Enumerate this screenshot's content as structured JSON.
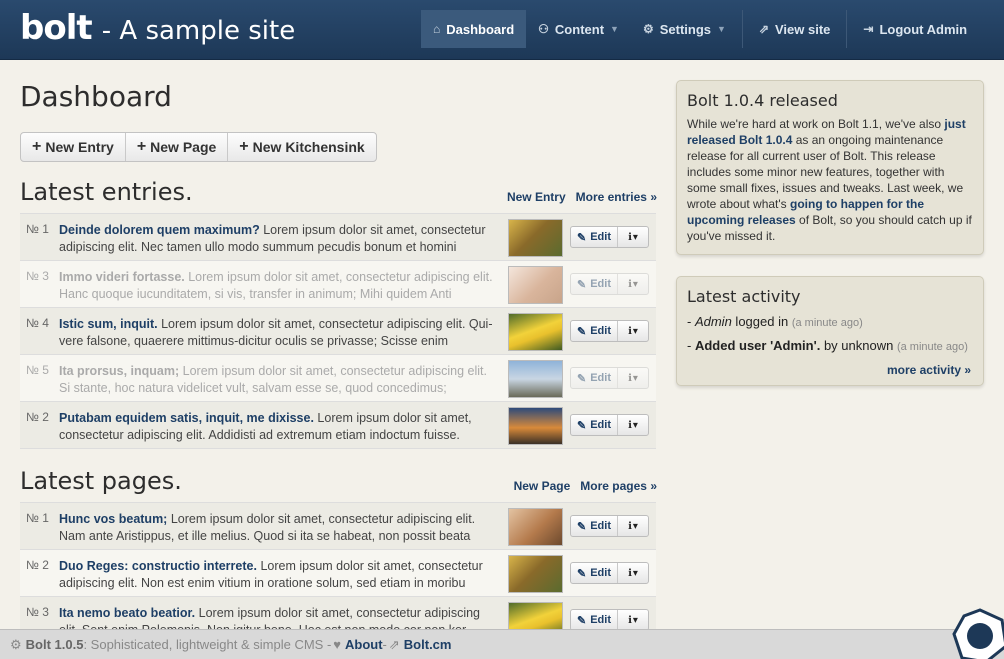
{
  "header": {
    "logo": "bolt",
    "subtitle": "- A sample site",
    "nav": [
      {
        "label": "Dashboard",
        "icon": "home-icon",
        "glyph": "⌂"
      },
      {
        "label": "Content",
        "icon": "sitemap-icon",
        "glyph": "⚇"
      },
      {
        "label": "Settings",
        "icon": "cogs-icon",
        "glyph": "⚙"
      },
      {
        "label": "View site",
        "icon": "external-link-icon",
        "glyph": "⇗"
      },
      {
        "label": "Logout Admin",
        "icon": "sign-out-icon",
        "glyph": "⇥"
      }
    ]
  },
  "main": {
    "title": "Dashboard",
    "new_buttons": [
      "New Entry",
      "New Page",
      "New Kitchensink"
    ],
    "entries": {
      "title": "Latest entries.",
      "new_link": "New Entry",
      "more_link": "More entries »",
      "rows": [
        {
          "num": "№ 1",
          "title": "Deinde dolorem quem maximum?",
          "text": "Lorem ipsum dolor sit amet, consectetur adipiscing elit. Nec tamen ullo modo summum pecudis bonum et homini",
          "thumb": "owl"
        },
        {
          "num": "№ 3",
          "title": "Immo videri fortasse.",
          "text": "Lorem ipsum dolor sit amet, consectetur adipiscing elit. Hanc quoque iucunditatem, si vis, transfer in animum; Mihi quidem Anti",
          "thumb": "rabbit"
        },
        {
          "num": "№ 4",
          "title": "Istic sum, inquit.",
          "text": "Lorem ipsum dolor sit amet, consectetur adipiscing elit. Qui-vere falsone, quaerere mittimus-dicitur oculis se privasse; Scisse enim",
          "thumb": "duck"
        },
        {
          "num": "№ 5",
          "title": "Ita prorsus, inquam;",
          "text": "Lorem ipsum dolor sit amet, consectetur adipiscing elit. Si stante, hoc natura videlicet vult, salvam esse se, quod concedimus;",
          "thumb": "landscape"
        },
        {
          "num": "№ 2",
          "title": "Putabam equidem satis, inquit, me dixisse.",
          "text": "Lorem ipsum dolor sit amet, consectetur adipiscing elit. Addidisti ad extremum etiam indoctum fuisse.",
          "thumb": "sunset"
        }
      ]
    },
    "pages": {
      "title": "Latest pages.",
      "new_link": "New Page",
      "more_link": "More pages »",
      "rows": [
        {
          "num": "№ 1",
          "title": "Hunc vos beatum;",
          "text": "Lorem ipsum dolor sit amet, consectetur adipiscing elit. Nam ante Aristippus, et ille melius. Quod si ita se habeat, non possit beata",
          "thumb": "lynx"
        },
        {
          "num": "№ 2",
          "title": "Duo Reges: constructio interrete.",
          "text": "Lorem ipsum dolor sit amet, consectetur adipiscing elit. Non est enim vitium in oratione solum, sed etiam in moribu",
          "thumb": "owl"
        },
        {
          "num": "№ 3",
          "title": "Ita nemo beato beatior.",
          "text": "Lorem ipsum dolor sit amet, consectetur adipiscing elit. Sent enim Polemonis. Non igitur bene. Hoc est non modo cor non ker",
          "thumb": "duck"
        }
      ]
    },
    "edit_label": "Edit"
  },
  "sidebar": {
    "news": {
      "title": "Bolt 1.0.4 released",
      "p1": "While we're hard at work on Bolt 1.1, we've also ",
      "link1": "just released Bolt 1.0.4",
      "p2": " as an ongoing maintenance release for all current user of Bolt. This release includes some minor new features, together with some small fixes, issues and tweaks. Last week, we wrote about what's ",
      "link2": "going to happen for the upcoming releases",
      "p3": " of Bolt, so you should catch up if you've missed it."
    },
    "activity": {
      "title": "Latest activity",
      "items": [
        {
          "prefix": "- ",
          "who": "Admin",
          "action": " logged in ",
          "when": "(a minute ago)"
        },
        {
          "prefix": "- ",
          "who": "Added user 'Admin'.",
          "action": " by unknown ",
          "when": "(a minute ago)"
        }
      ],
      "more": "more activity »"
    }
  },
  "footer": {
    "brand": "Bolt 1.0.5",
    "tagline": ": Sophisticated, lightweight & simple CMS - ",
    "about": "About",
    "sep": " - ",
    "site": "Bolt.cm"
  },
  "colors": {
    "accent": "#1e3f66",
    "header": "#1d3857",
    "background": "#f3f1ea"
  }
}
